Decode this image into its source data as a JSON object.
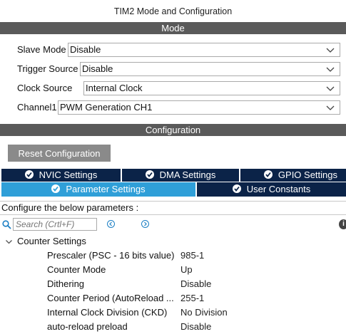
{
  "window": {
    "title": "TIM2 Mode and Configuration"
  },
  "mode": {
    "header": "Mode",
    "rows": [
      {
        "label": "Slave Mode",
        "value": "Disable"
      },
      {
        "label": "Trigger Source",
        "value": "Disable"
      },
      {
        "label": "Clock Source",
        "value": "Internal Clock"
      },
      {
        "label": "Channel1",
        "value": "PWM Generation CH1"
      }
    ]
  },
  "configuration": {
    "header": "Configuration",
    "reset_label": "Reset Configuration",
    "tabs_row1": [
      {
        "label": "NVIC Settings"
      },
      {
        "label": "DMA Settings"
      },
      {
        "label": "GPIO Settings"
      }
    ],
    "tabs_row2": [
      {
        "label": "Parameter Settings",
        "active": true
      },
      {
        "label": "User Constants",
        "active": false
      }
    ],
    "configure_text": "Configure the below parameters :",
    "search": {
      "placeholder": "Search (Crtl+F)"
    },
    "group": {
      "label": "Counter Settings",
      "params": [
        {
          "label": "Prescaler (PSC - 16 bits value)",
          "value": "985-1"
        },
        {
          "label": "Counter Mode",
          "value": "Up"
        },
        {
          "label": "Dithering",
          "value": "Disable"
        },
        {
          "label": "Counter Period (AutoReload ...",
          "value": "255-1"
        },
        {
          "label": "Internal Clock Division (CKD)",
          "value": "No Division"
        },
        {
          "label": "auto-reload preload",
          "value": "Disable"
        }
      ]
    }
  },
  "colors": {
    "section_bar": "#5a5a5a",
    "tab_dark": "#0b2348",
    "tab_active": "#2f9fd8",
    "button_gray": "#8a8a8a"
  },
  "icons": [
    "check-circle-icon",
    "chevron-down-icon",
    "search-icon",
    "arrow-left-icon",
    "arrow-right-icon",
    "info-icon",
    "collapse-chevron-icon"
  ]
}
